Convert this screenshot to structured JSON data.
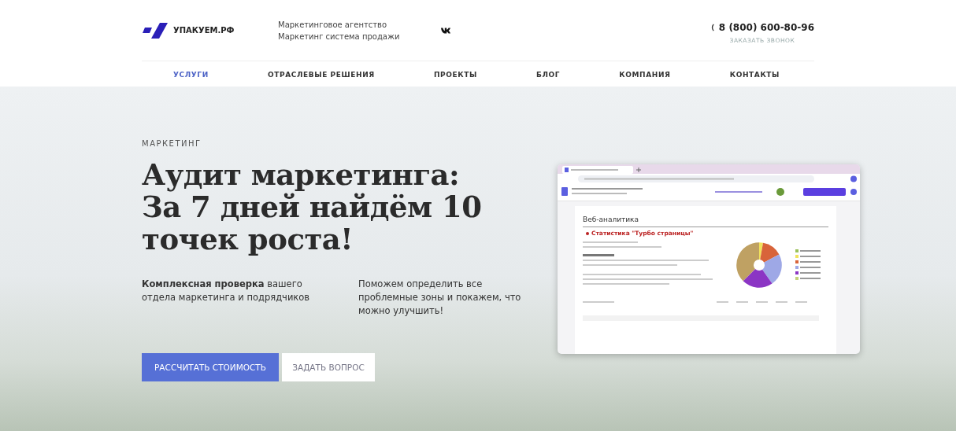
{
  "header": {
    "logo_text": "УПАКУЕМ.РФ",
    "tagline": [
      "Маркетинговое агентство",
      "Маркетинг система продажи"
    ],
    "phone": "8 (800) 600-80-96",
    "callback": "ЗАКАЗАТЬ ЗВОНОК"
  },
  "nav": [
    {
      "label": "УСЛУГИ",
      "selected": true
    },
    {
      "label": "ОТРАСЛЕВЫЕ РЕШЕНИЯ",
      "selected": false
    },
    {
      "label": "ПРОЕКТЫ",
      "selected": false
    },
    {
      "label": "БЛОГ",
      "selected": false
    },
    {
      "label": "КОМПАНИЯ",
      "selected": false
    },
    {
      "label": "КОНТАКТЫ",
      "selected": false
    }
  ],
  "hero": {
    "eyebrow": "МАРКЕТИНГ",
    "title_lines": [
      "Аудит маркетинга:",
      "За 7 дней найдём 10",
      "точек роста!"
    ],
    "lead": "**Комплексная проверка** вашего отдела маркетинга и подрядчиков",
    "note": "Поможем определить все проблемные зоны и покажем, что можно улучшить!",
    "buttons": [
      {
        "label": "РАССЧИТАТЬ СТОИМОСТЬ",
        "kind": "primary"
      },
      {
        "label": "ЗАДАТЬ ВОПРОС",
        "kind": "secondary"
      }
    ]
  },
  "browser": {
    "doc": {
      "heading": "Веб-аналитика",
      "subheading": "Статистика \"Турбо страницы\"",
      "legend": [
        {
          "color": "#9bc25a"
        },
        {
          "color": "#f1e35c"
        },
        {
          "color": "#d8643a"
        },
        {
          "color": "#9ea8e6"
        },
        {
          "color": "#8b35c4"
        },
        {
          "color": "#c4d27a"
        }
      ]
    }
  }
}
